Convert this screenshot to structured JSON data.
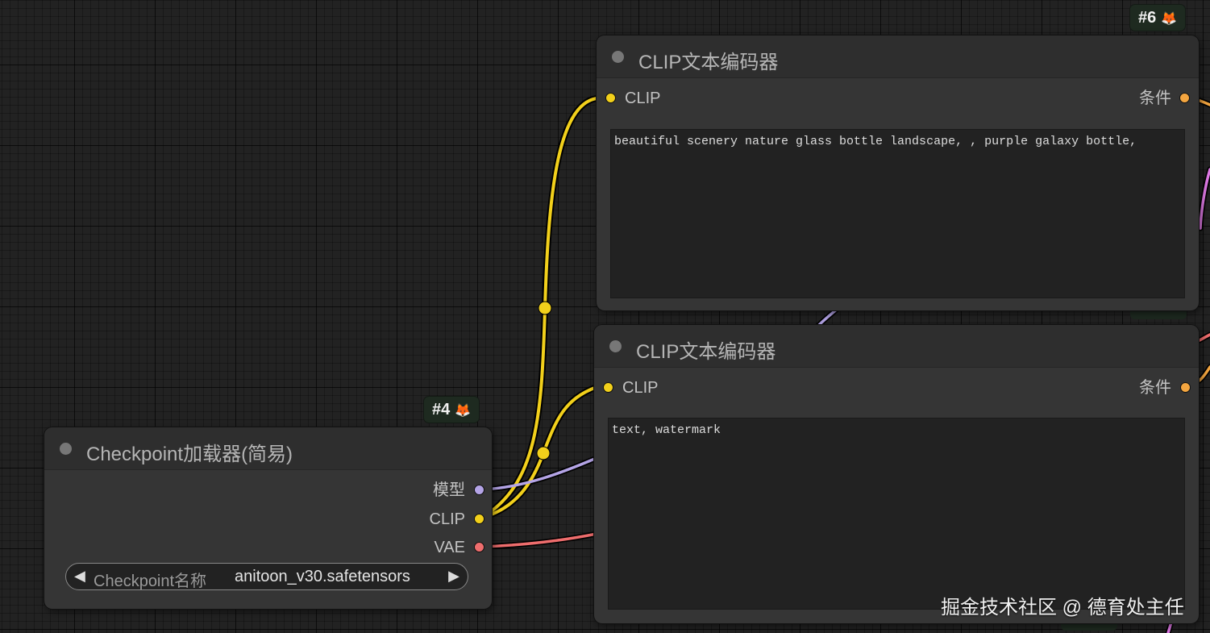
{
  "colors": {
    "clip": "#f2d01b",
    "model": "#b4a4e6",
    "vae": "#ee6d6d",
    "conditioning": "#f4a640",
    "latent": "#e07ae6"
  },
  "nodes": {
    "checkpoint": {
      "badge": "#4",
      "badge_icon": "🦊",
      "title": "Checkpoint加载器(简易)",
      "outputs": {
        "model": "模型",
        "clip": "CLIP",
        "vae": "VAE"
      },
      "widget": {
        "label": "Checkpoint名称",
        "value": "anitoon_v30.safetensors",
        "left_arrow": "◀",
        "right_arrow": "▶"
      }
    },
    "clip_positive": {
      "badge": "#6",
      "badge_icon": "🦊",
      "title": "CLIP文本编码器",
      "input_clip": "CLIP",
      "output_cond": "条件",
      "text": "beautiful scenery nature glass bottle landscape, , purple galaxy bottle,"
    },
    "clip_negative": {
      "title": "CLIP文本编码器",
      "input_clip": "CLIP",
      "output_cond": "条件",
      "text": "text, watermark"
    }
  },
  "watermark": "掘金技术社区 @ 德育处主任"
}
